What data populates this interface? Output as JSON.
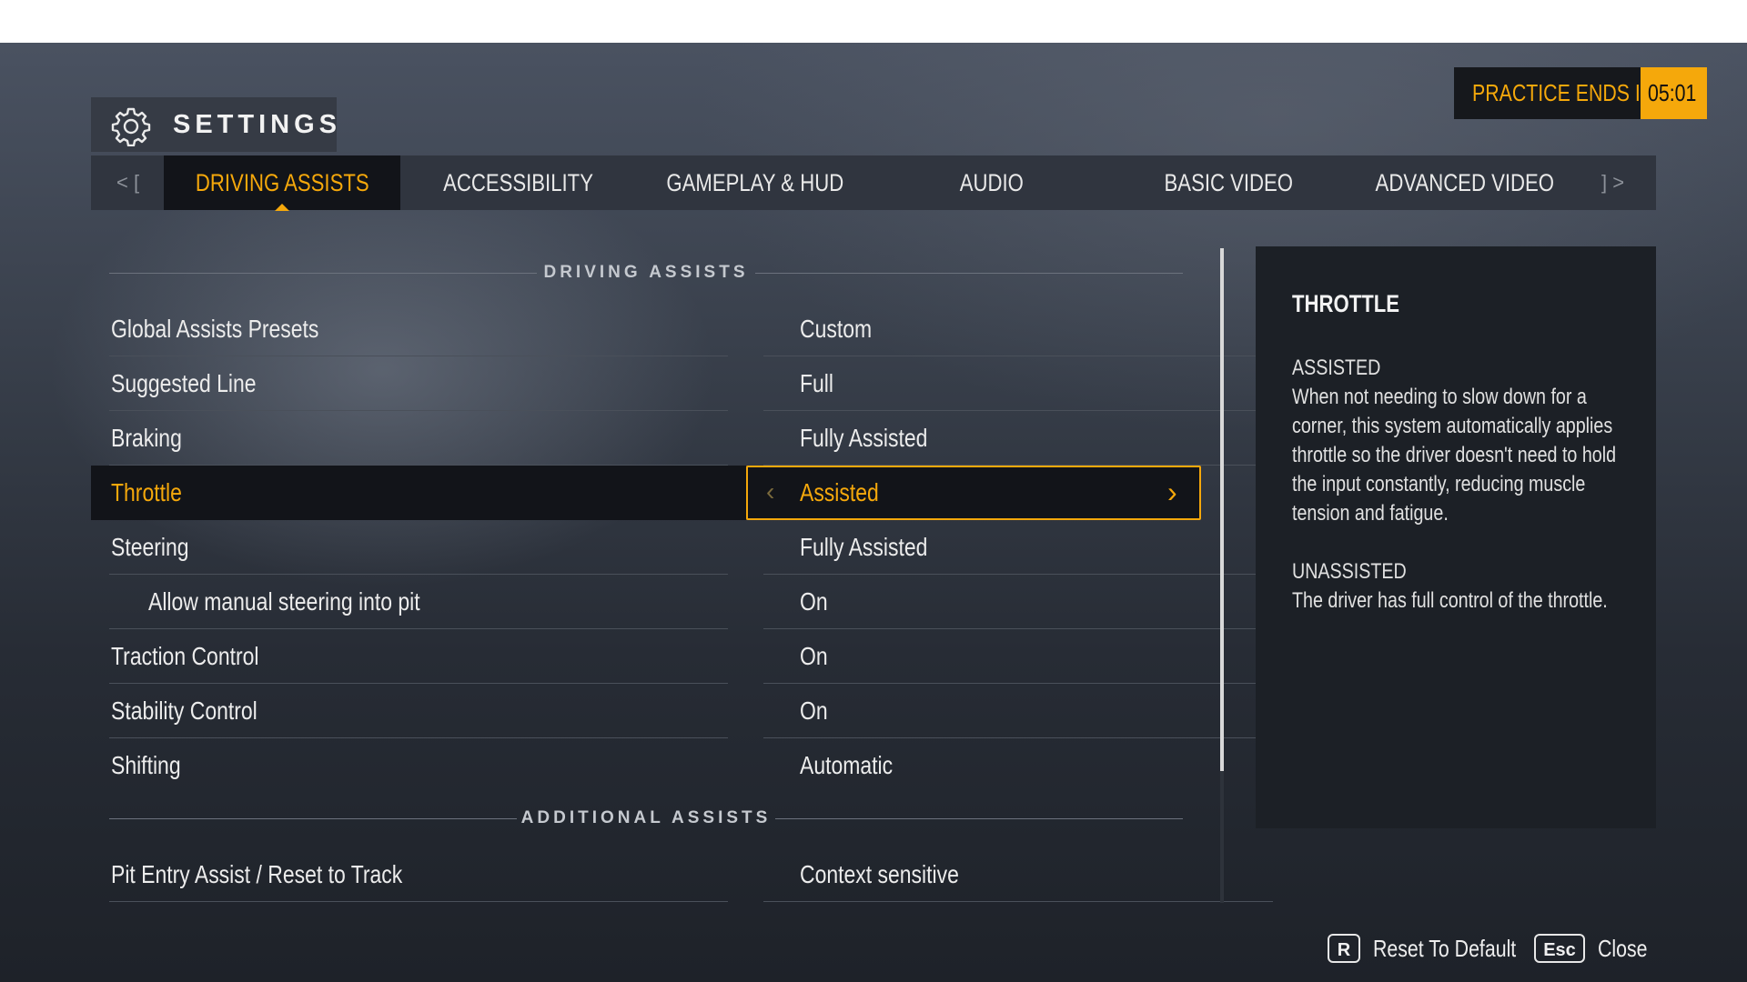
{
  "header": {
    "title": "SETTINGS"
  },
  "timer": {
    "label": "PRACTICE ENDS IN",
    "value": "05:01"
  },
  "tabs": {
    "left_hint": "<  [",
    "right_hint": "]  >",
    "items": [
      {
        "label": "DRIVING ASSISTS",
        "active": true
      },
      {
        "label": "ACCESSIBILITY"
      },
      {
        "label": "GAMEPLAY & HUD"
      },
      {
        "label": "AUDIO"
      },
      {
        "label": "BASIC VIDEO"
      },
      {
        "label": "ADVANCED VIDEO"
      }
    ]
  },
  "sections": {
    "driving": "DRIVING ASSISTS",
    "additional": "ADDITIONAL ASSISTS"
  },
  "settings": [
    {
      "name": "Global Assists Presets",
      "value": "Custom"
    },
    {
      "name": "Suggested Line",
      "value": "Full"
    },
    {
      "name": "Braking",
      "value": "Fully Assisted"
    },
    {
      "name": "Throttle",
      "value": "Assisted",
      "selected": true
    },
    {
      "name": "Steering",
      "value": "Fully Assisted"
    },
    {
      "name": "Allow manual steering into pit",
      "value": "On",
      "indent": true
    },
    {
      "name": "Traction Control",
      "value": "On"
    },
    {
      "name": "Stability Control",
      "value": "On"
    },
    {
      "name": "Shifting",
      "value": "Automatic"
    },
    {
      "name": "Pit Entry Assist / Reset to Track",
      "value": "Context sensitive"
    }
  ],
  "info": {
    "title": "THROTTLE",
    "assisted_heading": "ASSISTED",
    "assisted_text": "When not needing to slow down for a corner, this system automatically applies throttle so the driver doesn't need to hold the input constantly, reducing muscle tension and fatigue.",
    "unassisted_heading": "UNASSISTED",
    "unassisted_text": "The driver has full control of the throttle."
  },
  "footer": {
    "reset_key": "R",
    "reset_label": "Reset To Default",
    "close_key": "Esc",
    "close_label": "Close"
  },
  "colors": {
    "accent": "#f5a80b",
    "panel": "#121419"
  }
}
